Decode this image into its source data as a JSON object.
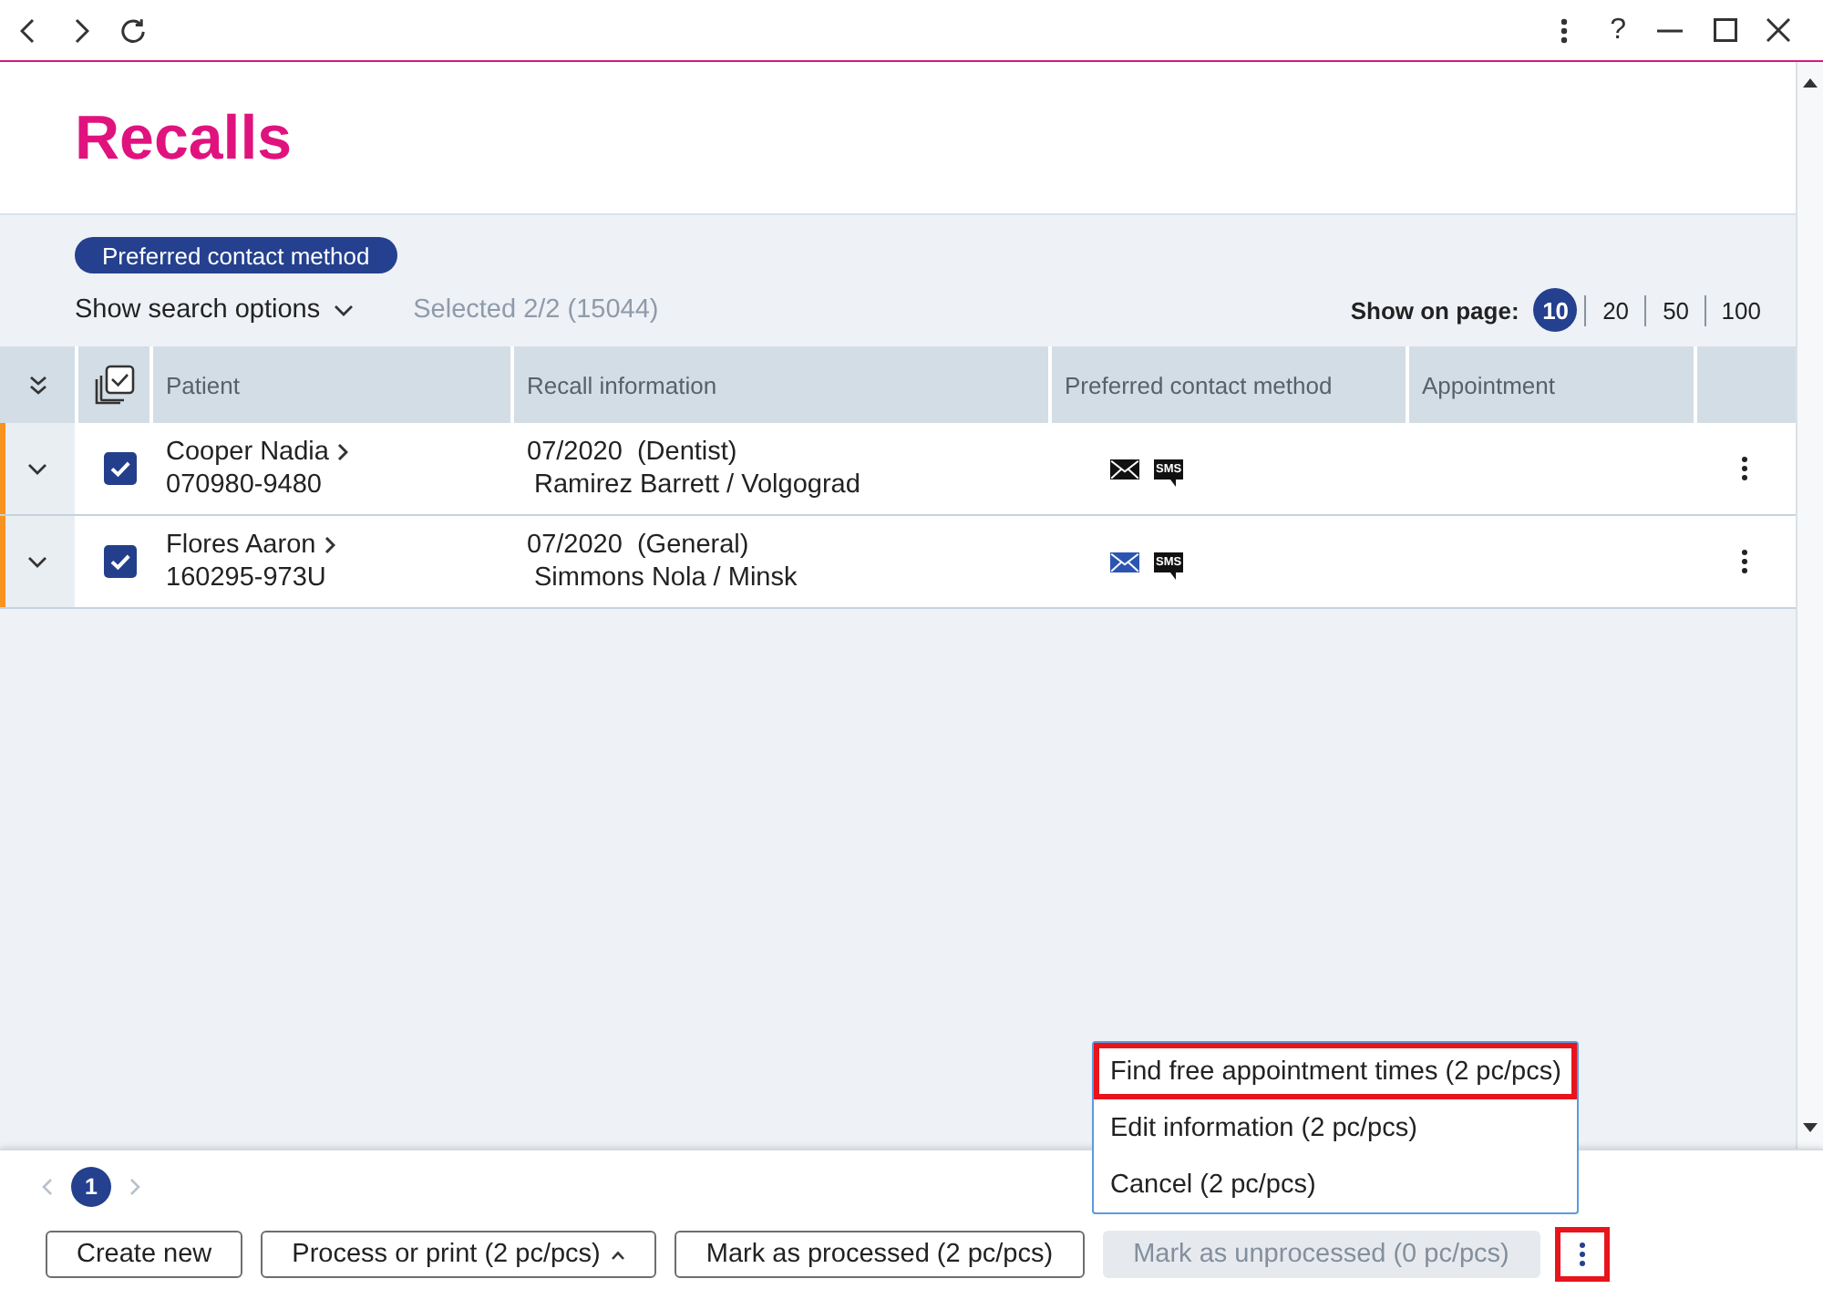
{
  "title_bar": {
    "help_label": "?"
  },
  "page": {
    "title": "Recalls"
  },
  "filters": {
    "chips": [
      {
        "label": "Preferred contact method"
      }
    ],
    "search_options": {
      "label": "Show search options",
      "expanded": false
    },
    "selection_summary": "Selected 2/2 (15044)",
    "page_size": {
      "label": "Show on page:",
      "options": [
        {
          "label": "10",
          "selected": true
        },
        {
          "label": "20",
          "selected": false
        },
        {
          "label": "50",
          "selected": false
        },
        {
          "label": "100",
          "selected": false
        }
      ]
    }
  },
  "table": {
    "columns": [
      {
        "label": "Patient"
      },
      {
        "label": "Recall information"
      },
      {
        "label": "Preferred contact method"
      },
      {
        "label": "Appointment"
      }
    ],
    "rows": [
      {
        "color": "#f7931e",
        "expanded": false,
        "checked": true,
        "patient": "Cooper Nadia",
        "patient_id": "070980-9480",
        "recall": "07/2020  (Dentist)",
        "recall_details": "Ramirez Barrett / Volgograd",
        "contact_methods": [
          {
            "kind": "email",
            "color": "#111111"
          },
          {
            "kind": "sms",
            "label": "SMS",
            "color": "#111111"
          }
        ]
      },
      {
        "color": "#f7931e",
        "expanded": false,
        "checked": true,
        "patient": "Flores Aaron",
        "patient_id": "160295-973U",
        "recall": "07/2020  (General)",
        "recall_details": "Simmons Nola / Minsk",
        "contact_methods": [
          {
            "kind": "email",
            "color": "#2b55b0"
          },
          {
            "kind": "sms",
            "label": "SMS",
            "color": "#111111"
          }
        ]
      }
    ]
  },
  "pagination": {
    "pages": [
      {
        "label": "1",
        "selected": true
      }
    ]
  },
  "actions": [
    {
      "kind": "button",
      "label": "Create new",
      "disabled": false,
      "highlighted": false
    },
    {
      "kind": "dropdown",
      "label": "Process or print (2 pc/pcs)",
      "disabled": false,
      "highlighted": false
    },
    {
      "kind": "button",
      "label": "Mark as processed (2 pc/pcs)",
      "disabled": false,
      "highlighted": false
    },
    {
      "kind": "button",
      "label": "Mark as unprocessed (0 pc/pcs)",
      "disabled": true,
      "highlighted": false
    },
    {
      "kind": "more",
      "disabled": false,
      "highlighted": true
    }
  ],
  "menu": {
    "items": [
      {
        "label": "Find free appointment times (2 pc/pcs)",
        "highlighted": true
      },
      {
        "label": "Edit information (2 pc/pcs)",
        "highlighted": false
      },
      {
        "label": "Cancel (2 pc/pcs)",
        "highlighted": false
      }
    ]
  }
}
